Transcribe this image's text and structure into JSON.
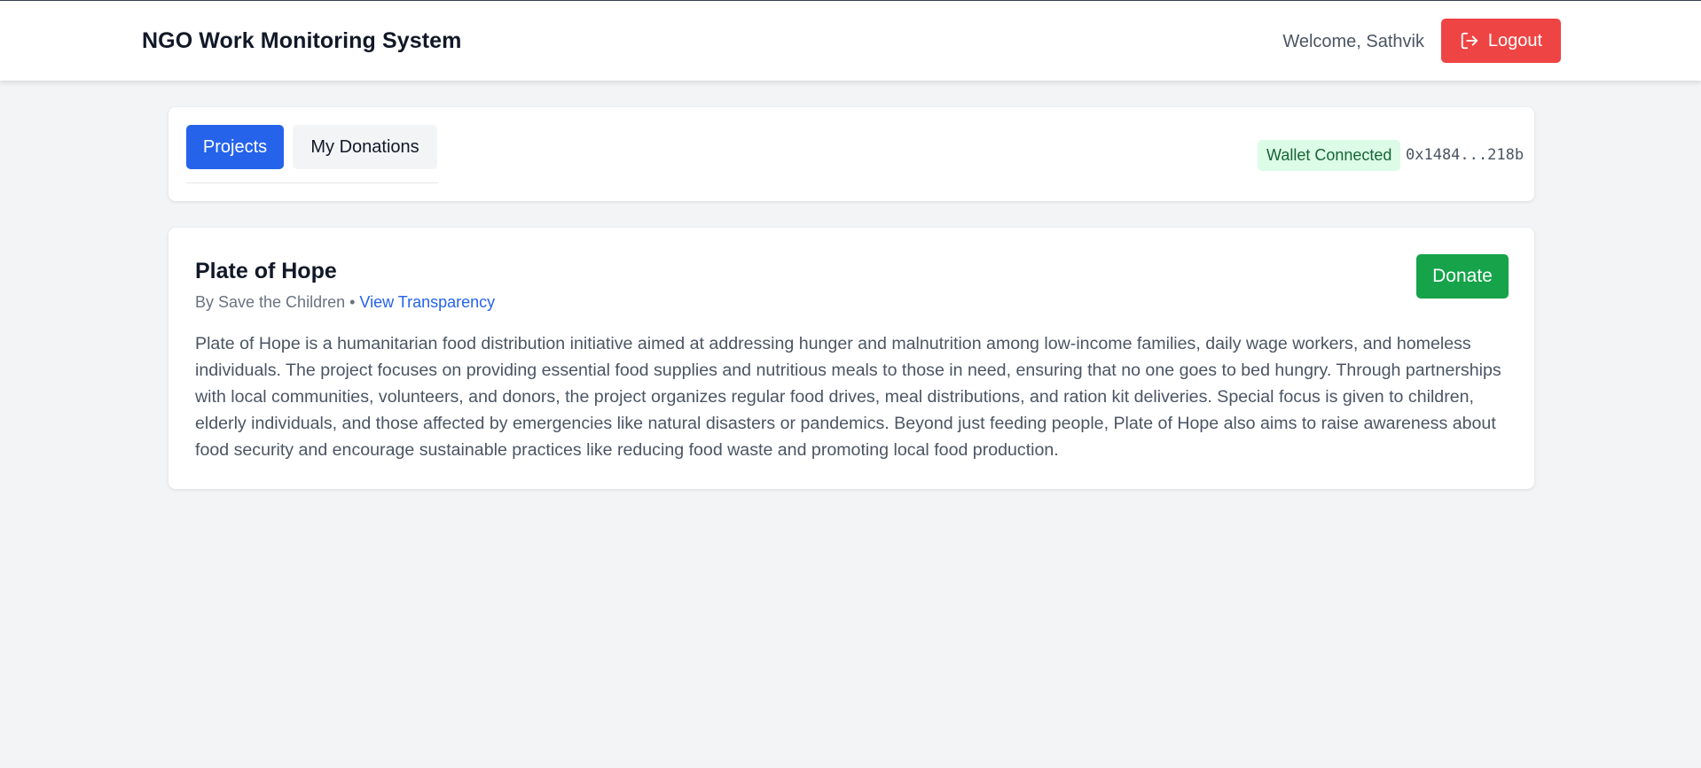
{
  "header": {
    "title": "NGO Work Monitoring System",
    "welcome_text": "Welcome, Sathvik",
    "logout_label": "Logout",
    "logout_icon": "logout-icon"
  },
  "tabs": [
    {
      "label": "Projects",
      "active": true
    },
    {
      "label": "My Donations",
      "active": false
    }
  ],
  "wallet": {
    "status": "Wallet Connected",
    "address": "0x1484...218b"
  },
  "project": {
    "title": "Plate of Hope",
    "by_prefix": "By Save the Children •",
    "transparency_link": "View Transparency",
    "donate_label": "Donate",
    "description": "Plate of Hope is a humanitarian food distribution initiative aimed at addressing hunger and malnutrition among low-income families, daily wage workers, and homeless individuals. The project focuses on providing essential food supplies and nutritious meals to those in need, ensuring that no one goes to bed hungry. Through partnerships with local communities, volunteers, and donors, the project organizes regular food drives, meal distributions, and ration kit deliveries. Special focus is given to children, elderly individuals, and those affected by emergencies like natural disasters or pandemics. Beyond just feeding people, Plate of Hope also aims to raise awareness about food security and encourage sustainable practices like reducing food waste and promoting local food production."
  },
  "colors": {
    "primary": "#2563eb",
    "danger": "#ef4444",
    "success": "#16a34a",
    "badge_bg": "#dcfce7",
    "page_bg": "#f3f4f6"
  }
}
